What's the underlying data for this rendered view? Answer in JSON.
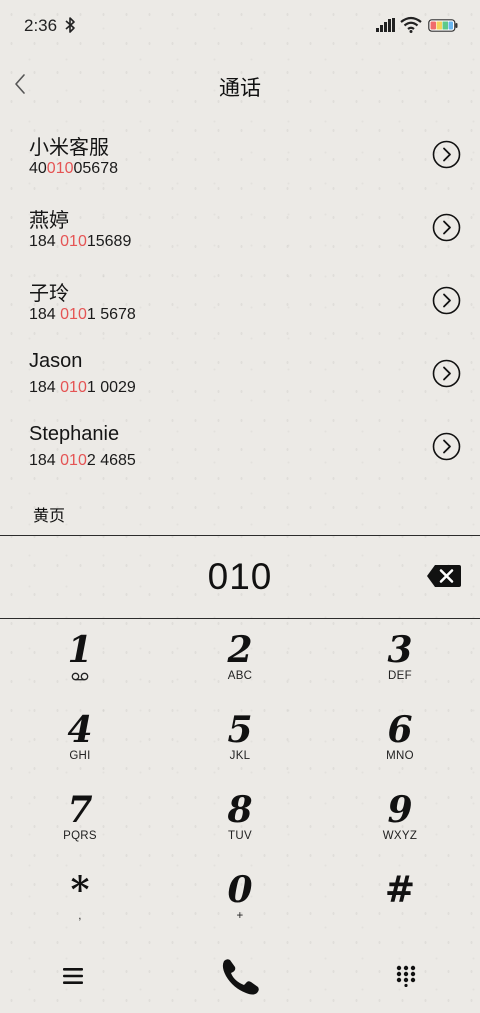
{
  "status": {
    "time": "2:36",
    "battery_colors": [
      "#f06b6b",
      "#f5d25a",
      "#5ec98a",
      "#6ab6f0"
    ]
  },
  "header": {
    "title": "通话"
  },
  "contacts": [
    {
      "name": "小米客服",
      "number_pre": "40",
      "number_hl": "010",
      "number_post": "05678"
    },
    {
      "name": "燕婷",
      "number_pre": "184 ",
      "number_hl": "010",
      "number_post": "15689"
    },
    {
      "name": "子玲",
      "number_pre": "184 ",
      "number_hl": "010",
      "number_post": "1 5678"
    },
    {
      "name": "Jason",
      "number_pre": "184 ",
      "number_hl": "010",
      "number_post": "1 0029"
    },
    {
      "name": "Stephanie",
      "number_pre": "184 ",
      "number_hl": "010",
      "number_post": "2 4685"
    }
  ],
  "section": {
    "yellow_pages": "黄页"
  },
  "dialer": {
    "input_value": "010"
  },
  "keypad": [
    {
      "digit": "1",
      "letters": ""
    },
    {
      "digit": "2",
      "letters": "ABC"
    },
    {
      "digit": "3",
      "letters": "DEF"
    },
    {
      "digit": "4",
      "letters": "GHI"
    },
    {
      "digit": "5",
      "letters": "JKL"
    },
    {
      "digit": "6",
      "letters": "MNO"
    },
    {
      "digit": "7",
      "letters": "PQRS"
    },
    {
      "digit": "8",
      "letters": "TUV"
    },
    {
      "digit": "9",
      "letters": "WXYZ"
    },
    {
      "digit": "*",
      "letters": ","
    },
    {
      "digit": "0",
      "letters": "+"
    },
    {
      "digit": "#",
      "letters": ""
    }
  ],
  "colors": {
    "highlight": "#e55454",
    "ink": "#111111",
    "paper": "#eceae6"
  }
}
